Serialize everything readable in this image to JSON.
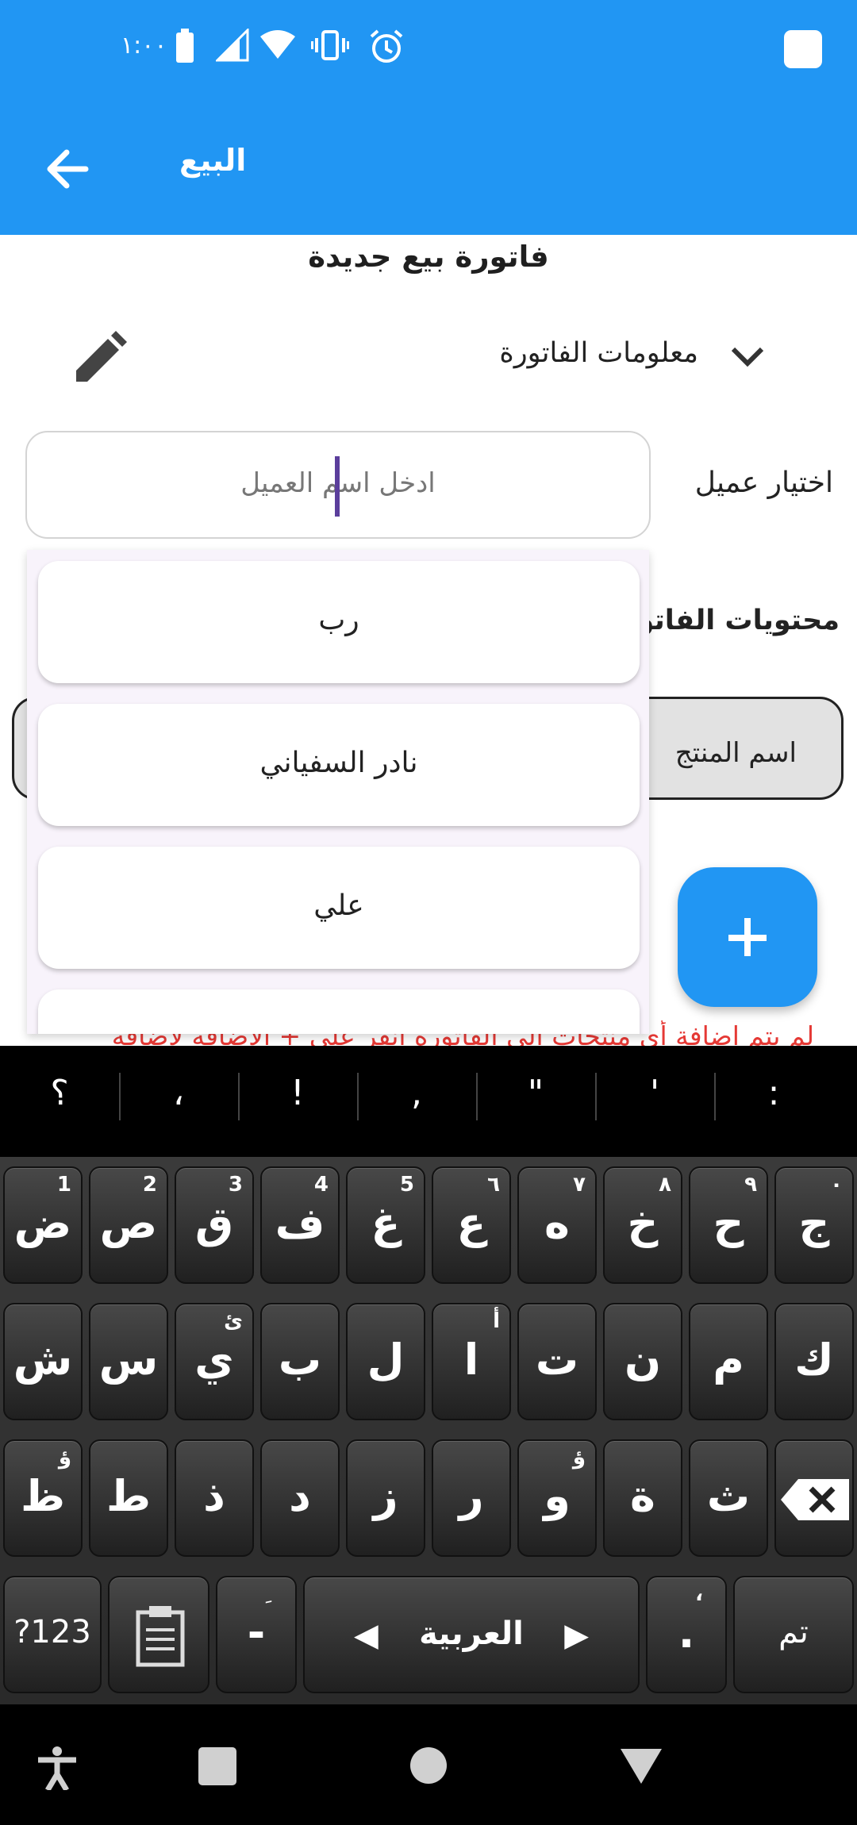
{
  "status_bar": {
    "time": "١:٠٠",
    "icons": [
      "battery-icon",
      "signal-icon",
      "wifi-icon",
      "vibrate-icon",
      "alarm-icon"
    ]
  },
  "app_bar": {
    "title": "البيع",
    "back_icon": "arrow-back-icon"
  },
  "page": {
    "title": "فاتورة بيع جديدة",
    "info_section_label": "معلومات الفاتورة",
    "client_label": "اختيار عميل",
    "client_placeholder": "ادخل اسم العميل",
    "contents_label": "محتويات الفاتورة",
    "table_header": {
      "product_column": "اسم المنتج"
    },
    "empty_message": "لم يتم إضافة أي منتجات الى الفاتورة انقر على + الإضافة لإضافة"
  },
  "dropdown": {
    "items": [
      "رب",
      "نادر السفياني",
      "علي"
    ]
  },
  "keyboard": {
    "suggestions": [
      "؟",
      "،",
      "!",
      ",",
      "\"",
      "'",
      ":"
    ],
    "row1": [
      {
        "label": "ض",
        "hint": "1"
      },
      {
        "label": "ص",
        "hint": "2"
      },
      {
        "label": "ق",
        "hint": "3"
      },
      {
        "label": "ف",
        "hint": "4"
      },
      {
        "label": "غ",
        "hint": "5"
      },
      {
        "label": "ع",
        "hint": "٦"
      },
      {
        "label": "ه",
        "hint": "٧"
      },
      {
        "label": "خ",
        "hint": "٨"
      },
      {
        "label": "ح",
        "hint": "٩"
      },
      {
        "label": "ج",
        "hint": "٠"
      }
    ],
    "row2": [
      {
        "label": "ش",
        "hint": ""
      },
      {
        "label": "س",
        "hint": ""
      },
      {
        "label": "ي",
        "hint": "ئ"
      },
      {
        "label": "ب",
        "hint": ""
      },
      {
        "label": "ل",
        "hint": ""
      },
      {
        "label": "ا",
        "hint": "أ"
      },
      {
        "label": "ت",
        "hint": ""
      },
      {
        "label": "ن",
        "hint": ""
      },
      {
        "label": "م",
        "hint": ""
      },
      {
        "label": "ك",
        "hint": ""
      }
    ],
    "row3": [
      {
        "label": "ظ",
        "hint": "ؤ"
      },
      {
        "label": "ط",
        "hint": ""
      },
      {
        "label": "ذ",
        "hint": ""
      },
      {
        "label": "د",
        "hint": ""
      },
      {
        "label": "ز",
        "hint": ""
      },
      {
        "label": "ر",
        "hint": ""
      },
      {
        "label": "و",
        "hint": "ؤ"
      },
      {
        "label": "ة",
        "hint": ""
      },
      {
        "label": "ث",
        "hint": ""
      }
    ],
    "bottom": {
      "symbols_key": "?123",
      "clipboard_icon": "clipboard-icon",
      "dash_key": "-",
      "dash_hint": "ِ",
      "space_label": "العربية",
      "period_key": ".",
      "period_hint": "،",
      "done_key": "تم",
      "backspace_icon": "backspace-icon"
    }
  },
  "nav_bar": {
    "icons": [
      "accessibility-icon",
      "recents-icon",
      "home-icon",
      "back-nav-icon"
    ]
  },
  "colors": {
    "primary": "#2196F3",
    "error": "#E53935",
    "caret": "#5B3E9C"
  }
}
